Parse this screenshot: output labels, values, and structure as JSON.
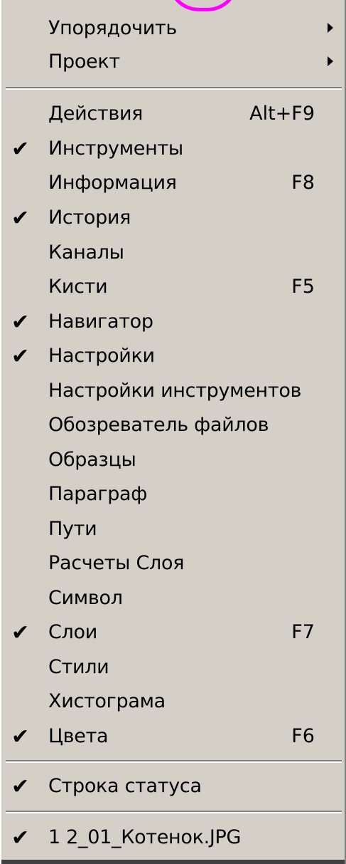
{
  "menu": {
    "group1": [
      {
        "label": "Упорядочить",
        "submenu": true
      },
      {
        "label": "Проект",
        "submenu": true
      }
    ],
    "group2": [
      {
        "label": "Действия",
        "shortcut": "Alt+F9",
        "checked": false
      },
      {
        "label": "Инструменты",
        "shortcut": "",
        "checked": true
      },
      {
        "label": "Информация",
        "shortcut": "F8",
        "checked": false
      },
      {
        "label": "История",
        "shortcut": "",
        "checked": true
      },
      {
        "label": "Каналы",
        "shortcut": "",
        "checked": false
      },
      {
        "label": "Кисти",
        "shortcut": "F5",
        "checked": false
      },
      {
        "label": "Навигатор",
        "shortcut": "",
        "checked": true
      },
      {
        "label": "Настройки",
        "shortcut": "",
        "checked": true
      },
      {
        "label": "Настройки инструментов",
        "shortcut": "",
        "checked": false
      },
      {
        "label": "Обозреватель файлов",
        "shortcut": "",
        "checked": false
      },
      {
        "label": "Образцы",
        "shortcut": "",
        "checked": false
      },
      {
        "label": "Параграф",
        "shortcut": "",
        "checked": false
      },
      {
        "label": "Пути",
        "shortcut": "",
        "checked": false
      },
      {
        "label": "Расчеты Слоя",
        "shortcut": "",
        "checked": false
      },
      {
        "label": "Символ",
        "shortcut": "",
        "checked": false
      },
      {
        "label": "Слои",
        "shortcut": "F7",
        "checked": true
      },
      {
        "label": "Стили",
        "shortcut": "",
        "checked": false
      },
      {
        "label": "Хистограма",
        "shortcut": "",
        "checked": false
      },
      {
        "label": "Цвета",
        "shortcut": "F6",
        "checked": true
      }
    ],
    "group3": [
      {
        "label": "Строка статуса",
        "shortcut": "",
        "checked": true
      }
    ],
    "group4": [
      {
        "label": "1 2_01_Котенок.JPG",
        "shortcut": "",
        "checked": true
      }
    ],
    "check_glyph": "✔",
    "colors": {
      "background": "#d4d0c8",
      "highlight_marker": "#ff00ff"
    }
  }
}
